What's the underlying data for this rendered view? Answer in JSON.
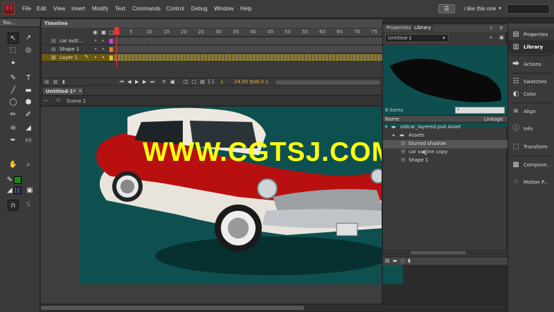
{
  "menubar": {
    "logo": "Fl",
    "items": [
      "File",
      "Edit",
      "View",
      "Insert",
      "Modify",
      "Text",
      "Commands",
      "Control",
      "Debug",
      "Window",
      "Help"
    ],
    "workspace_button": "☰",
    "workspace_label": "i like this one",
    "workspace_arrow": "▾"
  },
  "tools": {
    "header": "Too..."
  },
  "timeline": {
    "tab": "Timeline",
    "ruler": [
      "1",
      "5",
      "10",
      "15",
      "20",
      "25",
      "30",
      "35",
      "40",
      "45",
      "50",
      "55",
      "60",
      "65",
      "70",
      "75"
    ],
    "layers": [
      {
        "name": "car outl..."
      },
      {
        "name": "Shape 1"
      },
      {
        "name": "Layer 1"
      }
    ],
    "frame_number": "1",
    "fps": "24.00 fps",
    "time": "0.0 s"
  },
  "document": {
    "tab": "Untitled-1*",
    "close": "×",
    "scene": "Scene 1"
  },
  "watermark": "WWW.CGTSJ.COM",
  "library": {
    "tab_properties": "Properties",
    "tab_library": "Library",
    "document": "Untitled-1",
    "item_count": "8 items",
    "col_name": "Name",
    "col_linkage": "Linkage",
    "items": [
      {
        "name": "oldcar_layered.psd Asset",
        "indent": 0
      },
      {
        "name": "Assets",
        "indent": 1
      },
      {
        "name": "blurred shadow",
        "indent": 2
      },
      {
        "name": "car outline copy",
        "indent": 2
      },
      {
        "name": "Shape 1",
        "indent": 2
      }
    ]
  },
  "dock": {
    "items": [
      "Properties",
      "Library",
      "Actions",
      "Swatches",
      "Color",
      "Align",
      "Info",
      "Transform",
      "Compone...",
      "Motion P..."
    ]
  },
  "colors": {
    "stage": "#0e5050",
    "watermark": "#ffff10",
    "car_red": "#b81010",
    "selection_layer": "#6b5a10"
  }
}
